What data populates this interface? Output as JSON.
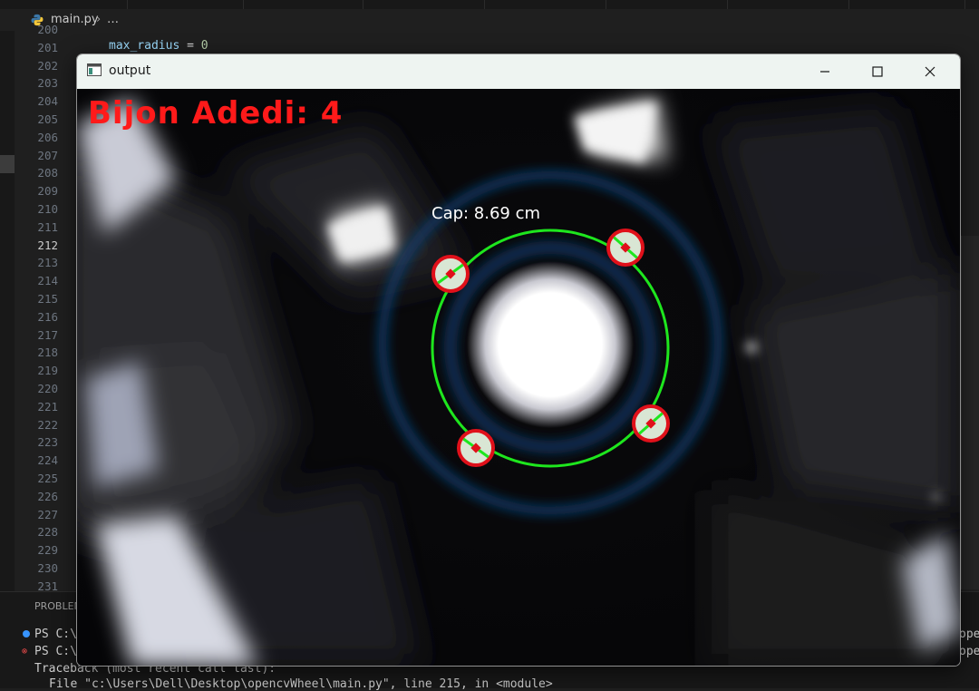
{
  "editor": {
    "file_name": "main.py",
    "breadcrumb_more": "…",
    "line_numbers": [
      "200",
      "201",
      "202",
      "203",
      "204",
      "205",
      "206",
      "207",
      "208",
      "209",
      "210",
      "211",
      "212",
      "213",
      "214",
      "215",
      "216",
      "217",
      "218",
      "219",
      "220",
      "221",
      "222",
      "223",
      "224",
      "225",
      "226",
      "227",
      "228",
      "229",
      "230",
      "231"
    ],
    "active_line": "212",
    "code_line_201": {
      "var": "max_radius",
      "op": " = ",
      "value": "0"
    }
  },
  "panel": {
    "title": "PROBLEM",
    "line1": "PS C:\\",
    "line2": "PS C:\\",
    "line3": "Traceback (most recent call last):",
    "line4": "File \"c:\\Users\\Dell\\Desktop\\opencvWheel\\main.py\", line 215, in <module>",
    "right1": "oper",
    "right2": "oper"
  },
  "window": {
    "title": "output",
    "icon": "opencv-window-icon",
    "controls": [
      "minimize-icon",
      "maximize-icon",
      "close-icon"
    ]
  },
  "overlay": {
    "count_label": "Bijon Adedi: 4",
    "diameter_label": "Cap: 8.69 cm",
    "count_color": "#ff1a1a",
    "circle_color": "#1ee61e",
    "marker_color": "#e0101a",
    "bolt_count": 4
  }
}
